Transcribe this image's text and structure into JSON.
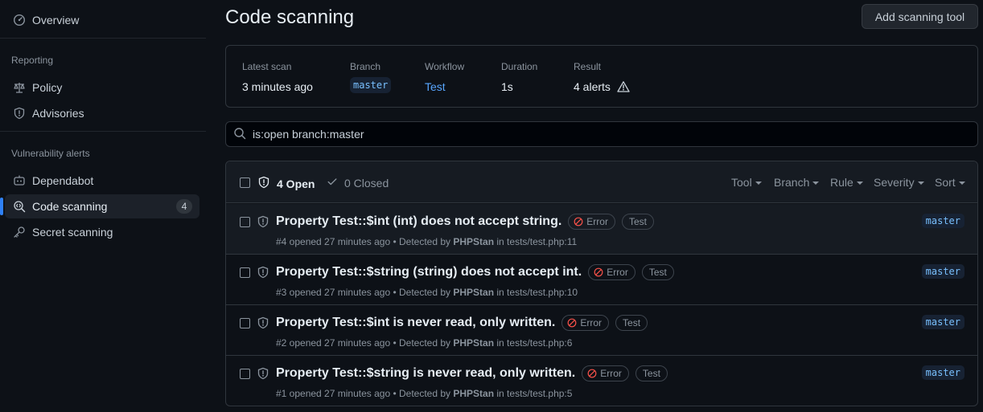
{
  "sidebar": {
    "overview": "Overview",
    "reporting_heading": "Reporting",
    "policy": "Policy",
    "advisories": "Advisories",
    "vuln_heading": "Vulnerability alerts",
    "dependabot": "Dependabot",
    "code_scanning": "Code scanning",
    "code_scanning_count": "4",
    "secret_scanning": "Secret scanning"
  },
  "header": {
    "title": "Code scanning",
    "add_tool": "Add scanning tool"
  },
  "summary": {
    "latest_scan_label": "Latest scan",
    "latest_scan_value": "3 minutes ago",
    "branch_label": "Branch",
    "branch_value": "master",
    "workflow_label": "Workflow",
    "workflow_value": "Test",
    "duration_label": "Duration",
    "duration_value": "1s",
    "result_label": "Result",
    "result_value": "4 alerts"
  },
  "search": {
    "value": "is:open branch:master"
  },
  "alerts_header": {
    "open": "4 Open",
    "closed": "0 Closed",
    "filters": [
      "Tool",
      "Branch",
      "Rule",
      "Severity",
      "Sort"
    ]
  },
  "alerts": [
    {
      "title": "Property Test::$int (int) does not accept string.",
      "severity": "Error",
      "tag": "Test",
      "meta_prefix": "#4 opened 27 minutes ago • Detected by ",
      "tool": "PHPStan",
      "meta_suffix": " in tests/test.php:11",
      "branch": "master"
    },
    {
      "title": "Property Test::$string (string) does not accept int.",
      "severity": "Error",
      "tag": "Test",
      "meta_prefix": "#3 opened 27 minutes ago • Detected by ",
      "tool": "PHPStan",
      "meta_suffix": " in tests/test.php:10",
      "branch": "master"
    },
    {
      "title": "Property Test::$int is never read, only written.",
      "severity": "Error",
      "tag": "Test",
      "meta_prefix": "#2 opened 27 minutes ago • Detected by ",
      "tool": "PHPStan",
      "meta_suffix": " in tests/test.php:6",
      "branch": "master"
    },
    {
      "title": "Property Test::$string is never read, only written.",
      "severity": "Error",
      "tag": "Test",
      "meta_prefix": "#1 opened 27 minutes ago • Detected by ",
      "tool": "PHPStan",
      "meta_suffix": " in tests/test.php:5",
      "branch": "master"
    }
  ],
  "colors": {
    "background": "#0d1117",
    "accent": "#2f81f7",
    "link": "#58a6ff",
    "error": "#f85149"
  }
}
